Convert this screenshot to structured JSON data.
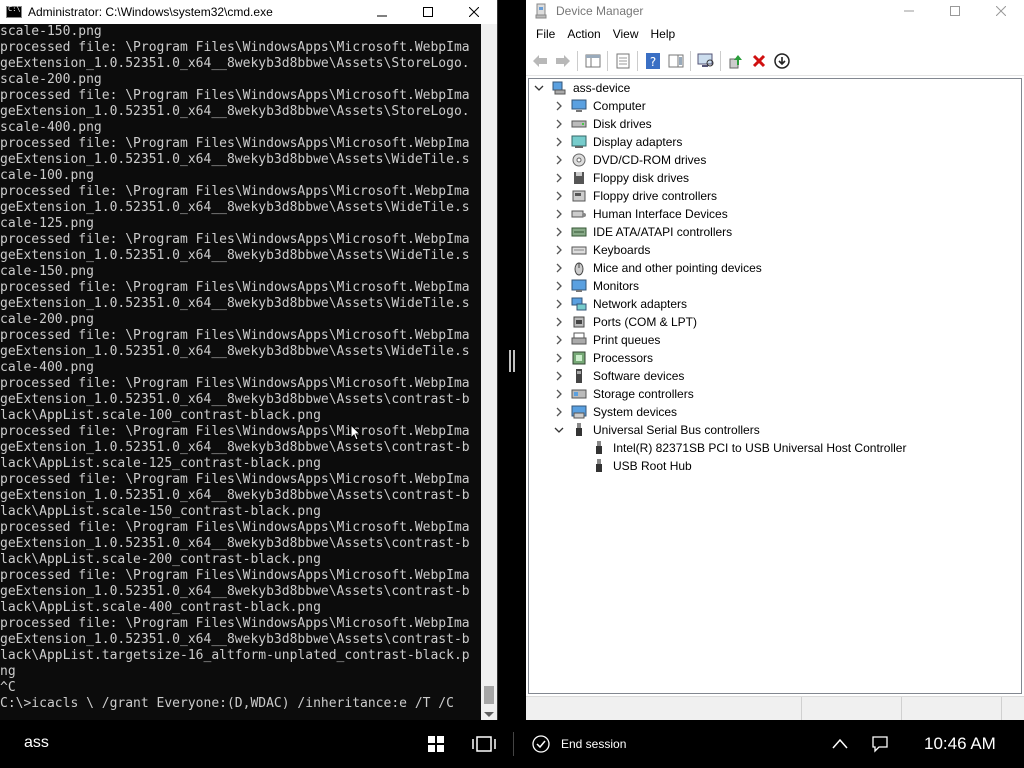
{
  "cmd": {
    "title": "Administrator: C:\\Windows\\system32\\cmd.exe",
    "lines": [
      "scale-150.png",
      "processed file: \\Program Files\\WindowsApps\\Microsoft.WebpIma",
      "geExtension_1.0.52351.0_x64__8wekyb3d8bbwe\\Assets\\StoreLogo.",
      "scale-200.png",
      "processed file: \\Program Files\\WindowsApps\\Microsoft.WebpIma",
      "geExtension_1.0.52351.0_x64__8wekyb3d8bbwe\\Assets\\StoreLogo.",
      "scale-400.png",
      "processed file: \\Program Files\\WindowsApps\\Microsoft.WebpIma",
      "geExtension_1.0.52351.0_x64__8wekyb3d8bbwe\\Assets\\WideTile.s",
      "cale-100.png",
      "processed file: \\Program Files\\WindowsApps\\Microsoft.WebpIma",
      "geExtension_1.0.52351.0_x64__8wekyb3d8bbwe\\Assets\\WideTile.s",
      "cale-125.png",
      "processed file: \\Program Files\\WindowsApps\\Microsoft.WebpIma",
      "geExtension_1.0.52351.0_x64__8wekyb3d8bbwe\\Assets\\WideTile.s",
      "cale-150.png",
      "processed file: \\Program Files\\WindowsApps\\Microsoft.WebpIma",
      "geExtension_1.0.52351.0_x64__8wekyb3d8bbwe\\Assets\\WideTile.s",
      "cale-200.png",
      "processed file: \\Program Files\\WindowsApps\\Microsoft.WebpIma",
      "geExtension_1.0.52351.0_x64__8wekyb3d8bbwe\\Assets\\WideTile.s",
      "cale-400.png",
      "processed file: \\Program Files\\WindowsApps\\Microsoft.WebpIma",
      "geExtension_1.0.52351.0_x64__8wekyb3d8bbwe\\Assets\\contrast-b",
      "lack\\AppList.scale-100_contrast-black.png",
      "processed file: \\Program Files\\WindowsApps\\Microsoft.WebpIma",
      "geExtension_1.0.52351.0_x64__8wekyb3d8bbwe\\Assets\\contrast-b",
      "lack\\AppList.scale-125_contrast-black.png",
      "processed file: \\Program Files\\WindowsApps\\Microsoft.WebpIma",
      "geExtension_1.0.52351.0_x64__8wekyb3d8bbwe\\Assets\\contrast-b",
      "lack\\AppList.scale-150_contrast-black.png",
      "processed file: \\Program Files\\WindowsApps\\Microsoft.WebpIma",
      "geExtension_1.0.52351.0_x64__8wekyb3d8bbwe\\Assets\\contrast-b",
      "lack\\AppList.scale-200_contrast-black.png",
      "processed file: \\Program Files\\WindowsApps\\Microsoft.WebpIma",
      "geExtension_1.0.52351.0_x64__8wekyb3d8bbwe\\Assets\\contrast-b",
      "lack\\AppList.scale-400_contrast-black.png",
      "processed file: \\Program Files\\WindowsApps\\Microsoft.WebpIma",
      "geExtension_1.0.52351.0_x64__8wekyb3d8bbwe\\Assets\\contrast-b",
      "lack\\AppList.targetsize-16_altform-unplated_contrast-black.p",
      "ng",
      "^C",
      "C:\\>icacls \\ /grant Everyone:(D,WDAC) /inheritance:e /T /C"
    ]
  },
  "device_manager": {
    "title": "Device Manager",
    "menu": [
      "File",
      "Action",
      "View",
      "Help"
    ],
    "root": "ass-device",
    "categories": [
      "Computer",
      "Disk drives",
      "Display adapters",
      "DVD/CD-ROM drives",
      "Floppy disk drives",
      "Floppy drive controllers",
      "Human Interface Devices",
      "IDE ATA/ATAPI controllers",
      "Keyboards",
      "Mice and other pointing devices",
      "Monitors",
      "Network adapters",
      "Ports (COM & LPT)",
      "Print queues",
      "Processors",
      "Software devices",
      "Storage controllers",
      "System devices",
      "Universal Serial Bus controllers"
    ],
    "usb_children": [
      "Intel(R) 82371SB PCI to USB Universal Host Controller",
      "USB Root Hub"
    ]
  },
  "taskbar": {
    "user": "ass",
    "end_session": "End session",
    "clock": "10:46 AM"
  },
  "icons": {
    "cmd_close": "close-icon",
    "dm_toolbar": [
      "back-arrow-icon",
      "forward-arrow-icon",
      "console-tree-icon",
      "properties-icon",
      "help-icon",
      "action-pane-icon",
      "scan-hardware-icon",
      "update-driver-icon",
      "uninstall-icon",
      "disable-device-icon"
    ]
  }
}
